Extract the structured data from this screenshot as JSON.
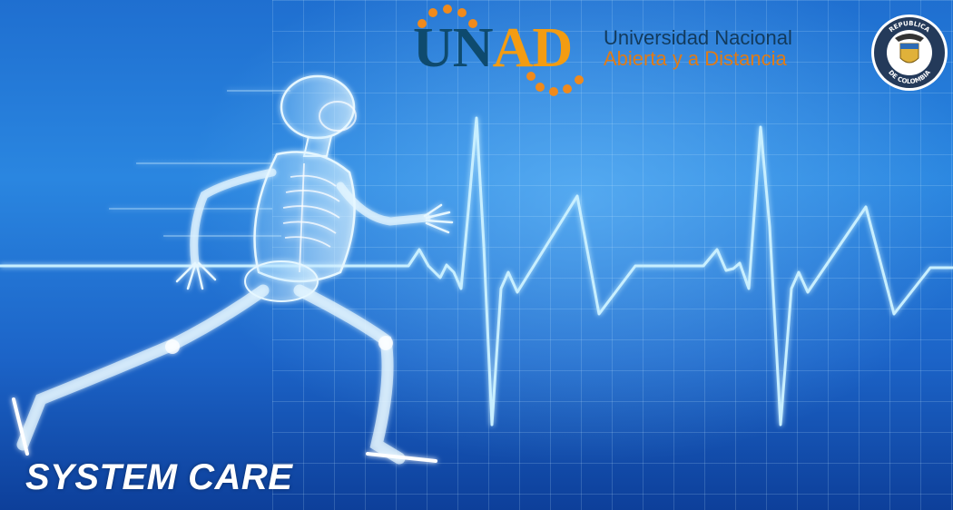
{
  "logo": {
    "unad_part1": "UN",
    "unad_part2": "AD",
    "name_line1": "Universidad Nacional",
    "name_line2": "Abierta y a Distancia"
  },
  "seal": {
    "text": "REPUBLICA DE COLOMBIA"
  },
  "banner": {
    "title": "SYSTEM CARE"
  },
  "colors": {
    "background": "#1f6fd0",
    "ecg_line": "#bfeaff",
    "unad_blue": "#0e4a6e",
    "unad_orange": "#f39c12"
  },
  "icons": [
    "runner-xray-figure",
    "ecg-heartbeat-line",
    "colombia-coat-of-arms-seal"
  ]
}
